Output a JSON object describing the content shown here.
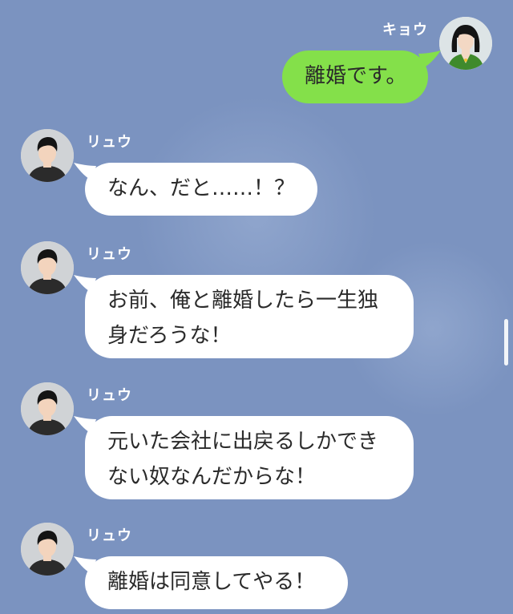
{
  "messages": [
    {
      "sender": "キョウ",
      "text": "離婚です。",
      "side": "right"
    },
    {
      "sender": "リュウ",
      "text": "なん、だと……！？",
      "side": "left"
    },
    {
      "sender": "リュウ",
      "lines": [
        "お前、俺と離婚したら一生独",
        "身だろうな！"
      ],
      "side": "left"
    },
    {
      "sender": "リュウ",
      "lines": [
        "元いた会社に出戻るしかでき",
        "ない奴なんだからな！"
      ],
      "side": "left"
    },
    {
      "sender": "リュウ",
      "text": "離婚は同意してやる！",
      "side": "left"
    }
  ],
  "colors": {
    "background": "#7b93c0",
    "my_bubble": "#84e04a",
    "other_bubble": "#ffffff",
    "name_text": "#ffffff"
  },
  "icons": {
    "kyou_avatar": "woman-avatar-icon",
    "ryuu_avatar": "man-avatar-icon"
  }
}
